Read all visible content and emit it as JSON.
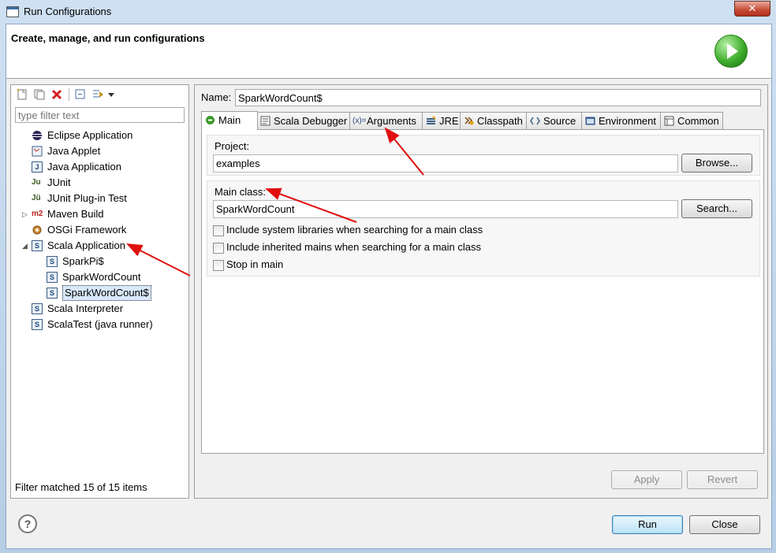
{
  "window": {
    "title": "Run Configurations",
    "close_label": "✕"
  },
  "header": {
    "title": "Create, manage, and run configurations"
  },
  "toolbar": {
    "icons": [
      "new-launch-config-icon",
      "duplicate-icon",
      "delete-icon",
      "collapse-all-icon",
      "filter-icon",
      "dropdown-arrow-icon"
    ]
  },
  "filter": {
    "placeholder": "type filter text",
    "status": "Filter matched 15 of 15 items"
  },
  "tree": {
    "items": [
      {
        "label": "Eclipse Application",
        "icon": "eclipse-icon"
      },
      {
        "label": "Java Applet",
        "icon": "java-applet-icon"
      },
      {
        "label": "Java Application",
        "icon": "java-application-icon"
      },
      {
        "label": "JUnit",
        "icon": "junit-icon"
      },
      {
        "label": "JUnit Plug-in Test",
        "icon": "junit-plugin-icon"
      },
      {
        "label": "Maven Build",
        "icon": "maven-icon"
      },
      {
        "label": "OSGi Framework",
        "icon": "osgi-icon"
      },
      {
        "label": "Scala Application",
        "icon": "scala-app-icon"
      },
      {
        "label": "SparkPi$",
        "icon": "scala-config-icon"
      },
      {
        "label": "SparkWordCount",
        "icon": "scala-config-icon"
      },
      {
        "label": "SparkWordCount$",
        "icon": "scala-config-icon"
      },
      {
        "label": "Scala Interpreter",
        "icon": "scala-app-icon"
      },
      {
        "label": "ScalaTest (java runner)",
        "icon": "scala-app-icon"
      }
    ]
  },
  "config": {
    "name_label": "Name:",
    "name_value": "SparkWordCount$",
    "tabs": [
      {
        "label": "Main"
      },
      {
        "label": "Scala Debugger"
      },
      {
        "label": "Arguments"
      },
      {
        "label": "JRE"
      },
      {
        "label": "Classpath"
      },
      {
        "label": "Source"
      },
      {
        "label": "Environment"
      },
      {
        "label": "Common"
      }
    ],
    "project_label": "Project:",
    "project_value": "examples",
    "browse_label": "Browse...",
    "main_class_label": "Main class:",
    "main_class_value": "SparkWordCount",
    "search_label": "Search...",
    "checkboxes": [
      {
        "label": "Include system libraries when searching for a main class",
        "checked": false
      },
      {
        "label": "Include inherited mains when searching for a main class",
        "checked": false
      },
      {
        "label": "Stop in main",
        "checked": false
      }
    ],
    "apply_label": "Apply",
    "revert_label": "Revert"
  },
  "footer": {
    "help_label": "?",
    "run_label": "Run",
    "close_label": "Close"
  },
  "colors": {
    "annotation_arrow": "#e01010",
    "selection": "#d9e8fb",
    "run_green": "#3fae2d"
  }
}
